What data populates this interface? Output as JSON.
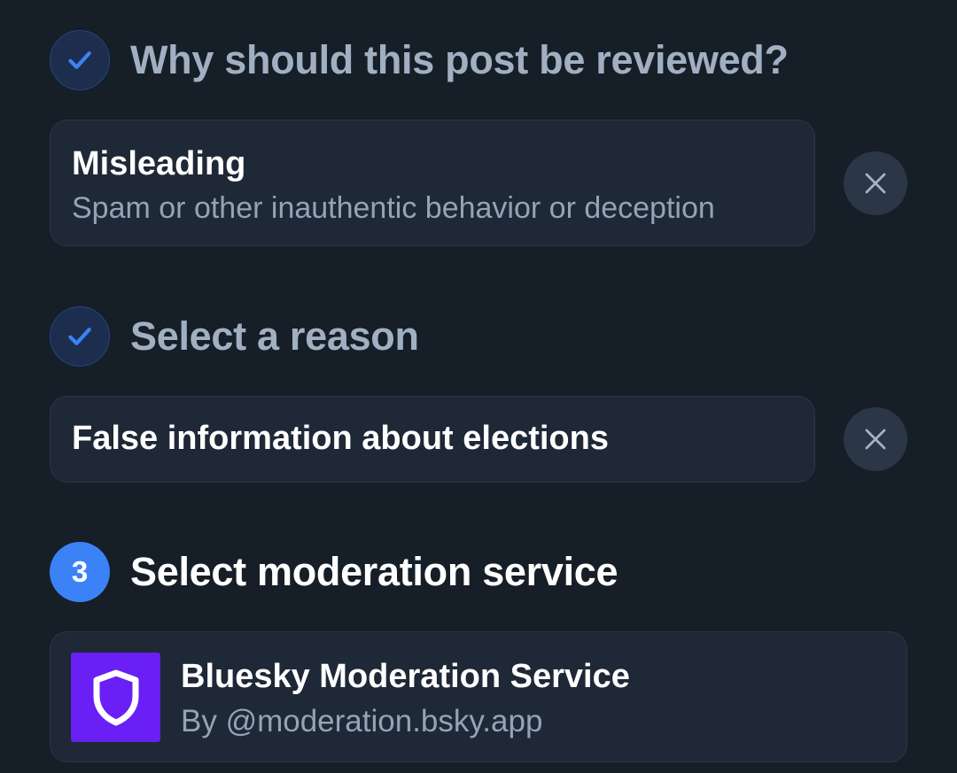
{
  "steps": [
    {
      "title": "Why should this post be reviewed?",
      "status": "done",
      "icon": "check-icon"
    },
    {
      "title": "Select a reason",
      "status": "done",
      "icon": "check-icon"
    },
    {
      "title": "Select moderation service",
      "status": "active",
      "number": "3"
    }
  ],
  "category": {
    "title": "Misleading",
    "description": "Spam or other inauthentic behavior or deception"
  },
  "reason": {
    "title": "False information about elections"
  },
  "service": {
    "name": "Bluesky Moderation Service",
    "by": "By @moderation.bsky.app",
    "icon": "shield-icon"
  },
  "colors": {
    "background": "#161e27",
    "card": "#1e2836",
    "accent": "#3b82f6",
    "service_logo": "#6a1ff4"
  }
}
